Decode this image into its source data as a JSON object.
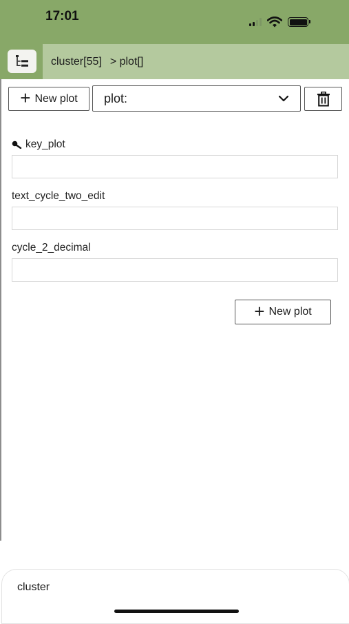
{
  "status_bar": {
    "time": "17:01",
    "icons": [
      "signal-icon",
      "wifi-icon",
      "battery-icon"
    ]
  },
  "nav": {
    "tree_icon": "tree-view-icon",
    "breadcrumb": [
      "cluster[55]",
      "> plot[]"
    ],
    "colors": {
      "primary": "#88a868",
      "secondary": "#b4c99e"
    }
  },
  "toolbar": {
    "new_plot_label": "New plot",
    "select_value": "plot:",
    "delete_icon": "trash-icon"
  },
  "form": {
    "fields": [
      {
        "label": "key_plot",
        "icon": "key-icon",
        "value": ""
      },
      {
        "label": "text_cycle_two_edit",
        "value": ""
      },
      {
        "label": "cycle_2_decimal",
        "value": ""
      }
    ],
    "new_plot_label": "New plot"
  },
  "bottom_sheet": {
    "label": "cluster"
  }
}
